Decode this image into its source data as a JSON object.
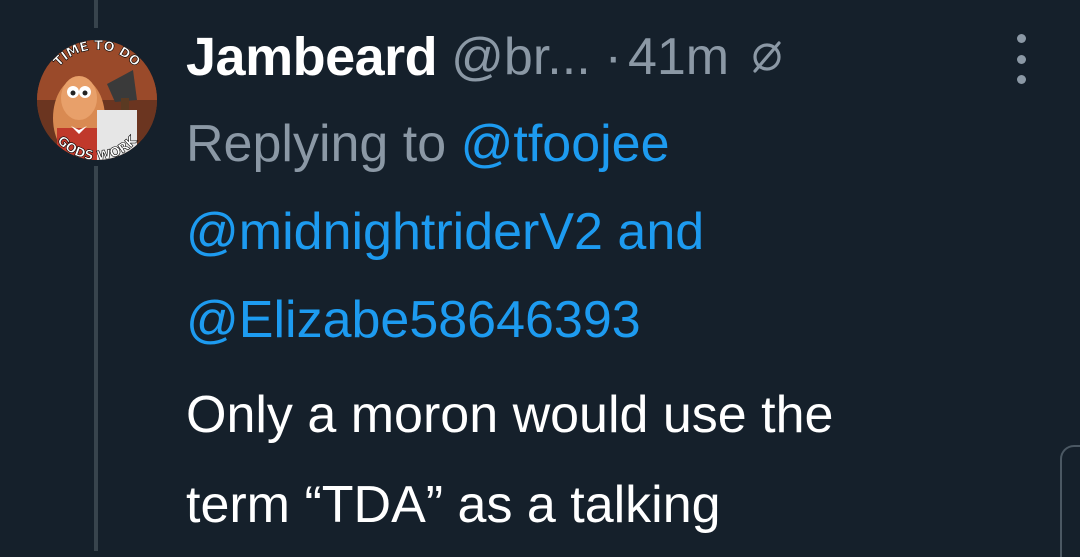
{
  "tweet": {
    "avatar_top_text": "TIME TO DO",
    "avatar_bottom_text": "GODS WORK",
    "display_name": "Jambeard",
    "handle": "@br...",
    "separator": "·",
    "timestamp": "41m",
    "replying_prefix": "Replying to",
    "mention_1": "@tfoojee",
    "mention_2": "@midnightriderV2",
    "conjunction": "and",
    "mention_3": "@Elizabe58646393",
    "text_line_1": "Only a moron would use the",
    "text_line_2": "term “TDA” as a talking"
  },
  "icons": {
    "no_circle": "circle-slash-icon",
    "more": "more-vertical-icon"
  },
  "colors": {
    "background": "#15202b",
    "name": "#ffffff",
    "muted": "#8b98a5",
    "link": "#1d9bf0",
    "thread_line": "#38444d"
  }
}
